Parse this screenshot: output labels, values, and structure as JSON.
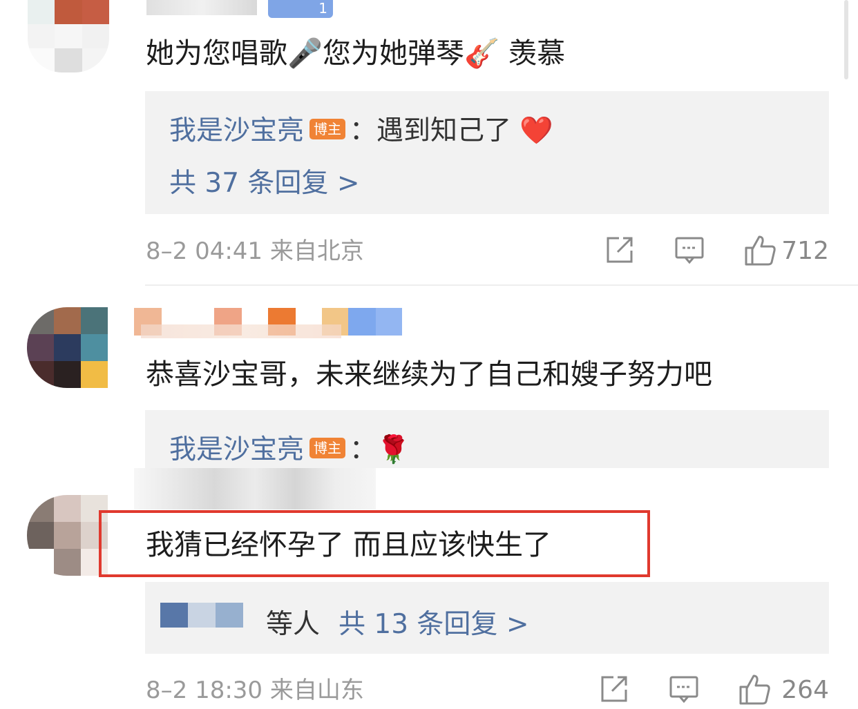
{
  "comments": [
    {
      "text": "她为您唱歌🎤您为她弹琴🎸 羡慕",
      "reply": {
        "author": "我是沙宝亮",
        "badge": "博主",
        "sep": "：",
        "text": "遇到知己了 ❤️"
      },
      "more": "共 37 条回复 >",
      "meta": "8–2 04:41 来自北京",
      "likes": "712",
      "level_badge": "1"
    },
    {
      "text": "恭喜沙宝哥，未来继续为了自己和嫂子努力吧",
      "reply": {
        "author": "我是沙宝亮",
        "badge": "博主",
        "sep": "：",
        "text": "🌹"
      }
    },
    {
      "text": "我猜已经怀孕了  而且应该快生了",
      "more_prefix": "等人",
      "more": "共 13 条回复 >",
      "meta": "8–2 18:30 来自山东",
      "likes": "264"
    }
  ],
  "icons": {
    "share": "share-icon",
    "comment": "comment-icon",
    "like": "thumbs-up-icon"
  },
  "colors": {
    "link": "#4f6f9f",
    "badge": "#f08335",
    "highlight": "#e0392e",
    "reply_bg": "#f2f2f2"
  }
}
